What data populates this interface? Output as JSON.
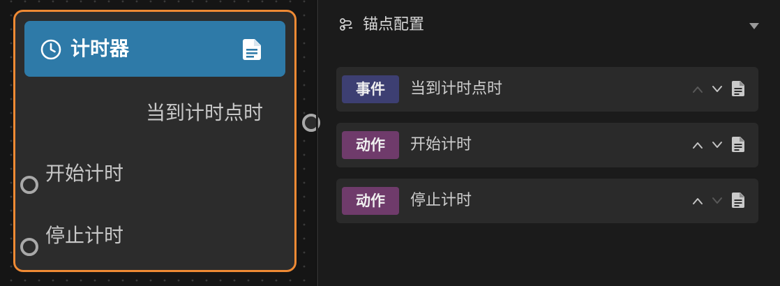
{
  "node": {
    "title": "计时器",
    "output_ports": [
      "当到计时点时"
    ],
    "input_ports": [
      "开始计时",
      "停止计时"
    ],
    "icons": {
      "title": "clock-icon",
      "doc": "document-icon"
    },
    "header_color": "#2e7aa8",
    "selected_border_color": "#ef8a34"
  },
  "panel": {
    "title": "锚点配置",
    "icons": {
      "title": "anchor-link-icon",
      "collapse": "caret-down-icon"
    },
    "rows": [
      {
        "badge": "事件",
        "badge_color": "#3d3f72",
        "name": "当到计时点时",
        "move_up_enabled": false,
        "move_down_enabled": true
      },
      {
        "badge": "动作",
        "badge_color": "#6f3b6b",
        "name": "开始计时",
        "move_up_enabled": true,
        "move_down_enabled": true
      },
      {
        "badge": "动作",
        "badge_color": "#6f3b6b",
        "name": "停止计时",
        "move_up_enabled": true,
        "move_down_enabled": false
      }
    ]
  }
}
